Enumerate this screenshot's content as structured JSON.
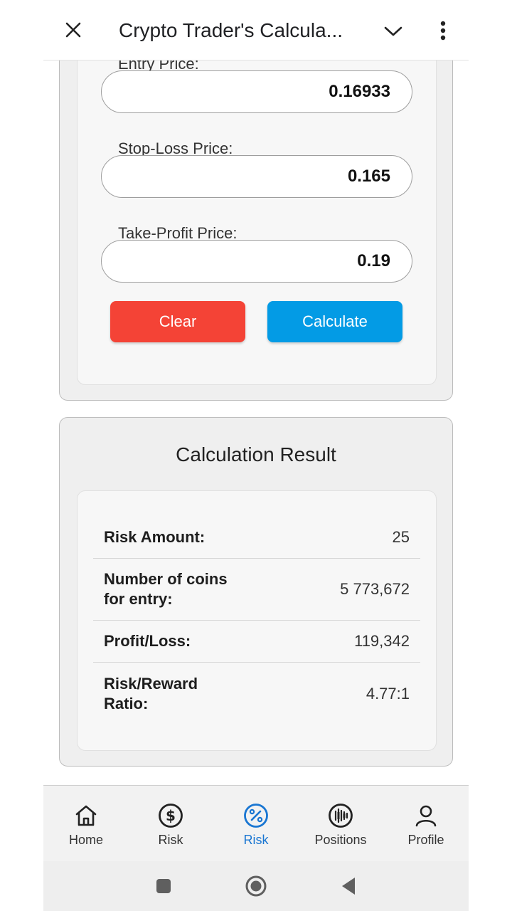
{
  "header": {
    "title": "Crypto Trader's Calcula..."
  },
  "form": {
    "entry_label": "Entry Price:",
    "entry_value": "0.16933",
    "stoploss_label": "Stop-Loss Price:",
    "stoploss_value": "0.165",
    "takeprofit_label": "Take-Profit Price:",
    "takeprofit_value": "0.19",
    "clear_label": "Clear",
    "calculate_label": "Calculate"
  },
  "result": {
    "title": "Calculation Result",
    "rows": [
      {
        "label": "Risk Amount:",
        "value": "25"
      },
      {
        "label": "Number of coins for entry:",
        "value": "5 773,672"
      },
      {
        "label": "Profit/Loss:",
        "value": "119,342"
      },
      {
        "label": "Risk/Reward Ratio:",
        "value": "4.77:1"
      }
    ]
  },
  "bottom_nav": {
    "items": [
      {
        "label": "Home",
        "icon": "home-icon"
      },
      {
        "label": "Risk",
        "icon": "dollar-circle-icon"
      },
      {
        "label": "Risk",
        "icon": "percent-circle-icon",
        "active": true
      },
      {
        "label": "Positions",
        "icon": "candlestick-icon"
      },
      {
        "label": "Profile",
        "icon": "person-icon"
      }
    ]
  },
  "colors": {
    "clear_button": "#f44336",
    "calculate_button": "#039be5",
    "active_nav": "#1976d2"
  }
}
